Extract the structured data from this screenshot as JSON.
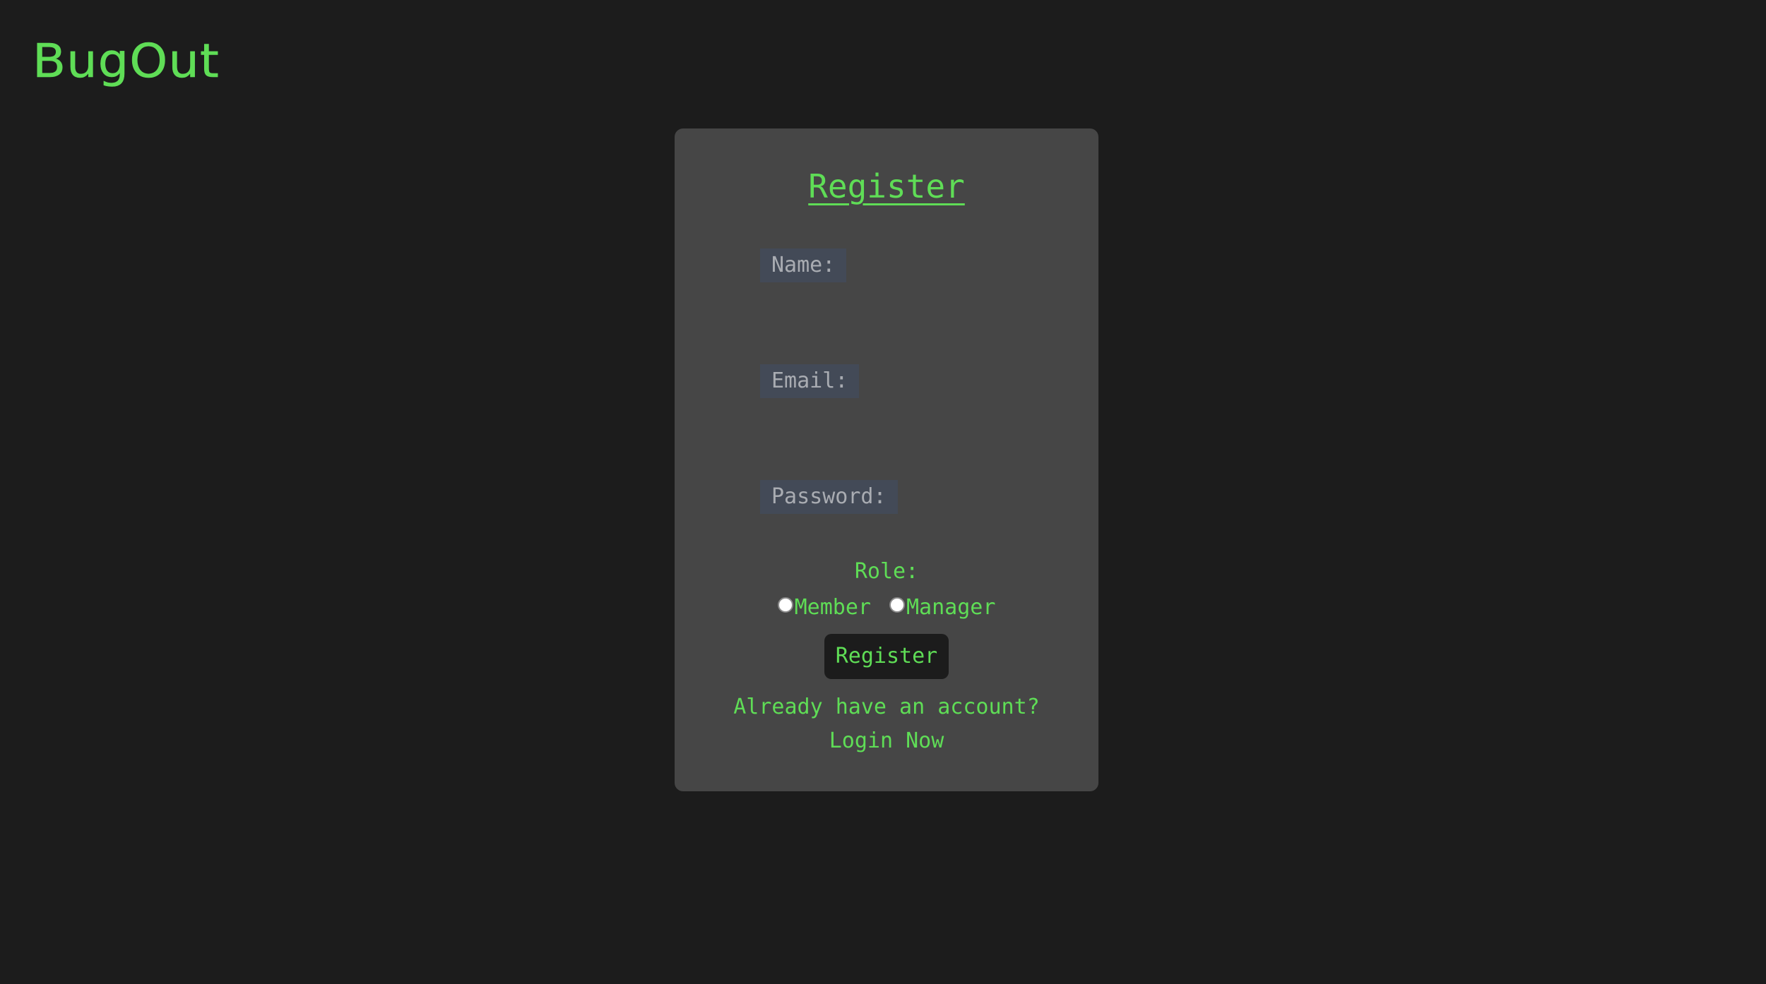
{
  "brand": {
    "logo_text": "BugOut",
    "accent_color": "#5fdd56",
    "background_color": "#1c1c1c",
    "card_color": "#464646"
  },
  "form": {
    "title": "Register",
    "name_label": "Name:",
    "email_label": "Email:",
    "password_label": "Password:",
    "name_value": "",
    "email_value": "",
    "password_value": "",
    "role": {
      "label": "Role:",
      "options": [
        "Member",
        "Manager"
      ],
      "selected": null
    },
    "submit_label": "Register",
    "footer_prompt": "Already have an account?",
    "login_link": "Login Now"
  }
}
